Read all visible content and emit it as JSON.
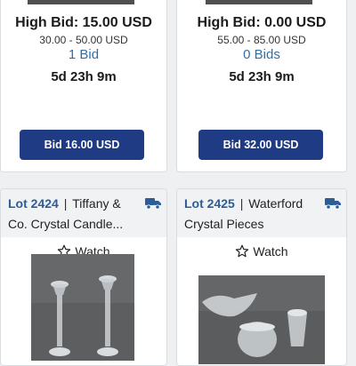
{
  "lots": [
    {
      "high_bid": "High Bid: 15.00 USD",
      "estimate": "30.00 - 50.00 USD",
      "bids": "1 Bid",
      "time_left": "5d 23h 9m",
      "bid_button": "Bid 16.00 USD"
    },
    {
      "high_bid": "High Bid: 0.00 USD",
      "estimate": "55.00 - 85.00 USD",
      "bids": "0 Bids",
      "time_left": "5d 23h 9m",
      "bid_button": "Bid 32.00 USD"
    },
    {
      "lot_number": "Lot 2424",
      "title_line1": "Tiffany &",
      "title_line2": "Co. Crystal Candle...",
      "watch_label": "Watch",
      "icon": "shipping-truck-icon"
    },
    {
      "lot_number": "Lot 2425",
      "title_line1": "Waterford",
      "title_line2": "Crystal Pieces",
      "watch_label": "Watch",
      "icon": "shipping-truck-icon"
    }
  ],
  "colors": {
    "accent_blue": "#1e3b83",
    "link_blue": "#2f6fa8",
    "lot_number": "#2d5d96"
  }
}
